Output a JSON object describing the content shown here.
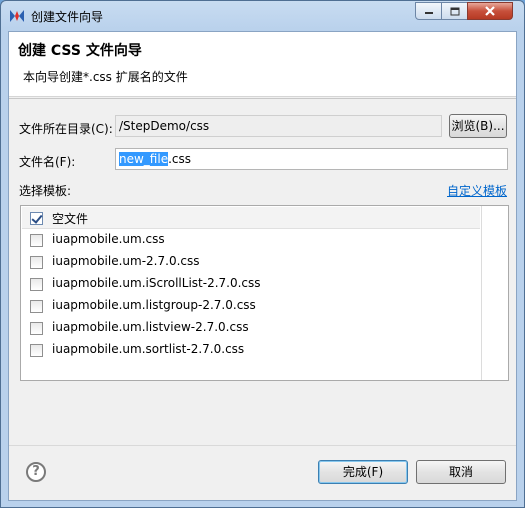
{
  "window": {
    "title": "创建文件向导",
    "controls": {
      "minimize_icon": "minimize-icon",
      "maximize_icon": "maximize-icon",
      "close_icon": "close-icon"
    }
  },
  "banner": {
    "title": "创建 CSS 文件向导",
    "description": "本向导创建*.css 扩展名的文件"
  },
  "directory": {
    "label": "文件所在目录(C):",
    "value": "/StepDemo/css",
    "browse_label": "浏览(B)..."
  },
  "filename": {
    "label": "文件名(F):",
    "value_selected": "new_file",
    "value_rest": ".css"
  },
  "template": {
    "label": "选择模板:",
    "custom_link": "自定义模板",
    "items": [
      {
        "label": "空文件",
        "checked": true
      },
      {
        "label": "iuapmobile.um.css",
        "checked": false
      },
      {
        "label": "iuapmobile.um-2.7.0.css",
        "checked": false
      },
      {
        "label": "iuapmobile.um.iScrollList-2.7.0.css",
        "checked": false
      },
      {
        "label": "iuapmobile.um.listgroup-2.7.0.css",
        "checked": false
      },
      {
        "label": "iuapmobile.um.listview-2.7.0.css",
        "checked": false
      },
      {
        "label": "iuapmobile.um.sortlist-2.7.0.css",
        "checked": false
      }
    ]
  },
  "footer": {
    "help_icon": "help-icon",
    "finish_label": "完成(F)",
    "cancel_label": "取消"
  }
}
